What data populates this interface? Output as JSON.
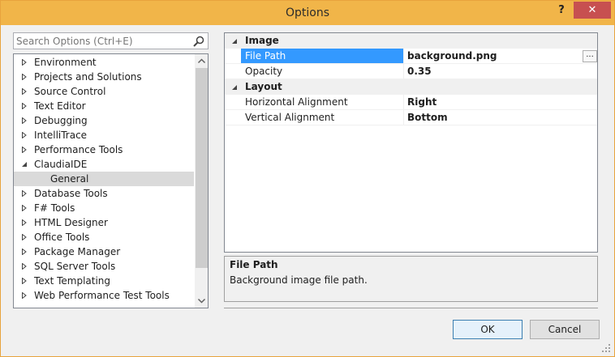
{
  "window": {
    "title": "Options",
    "help": "?",
    "close": "✕"
  },
  "search": {
    "placeholder": "Search Options (Ctrl+E)"
  },
  "tree": {
    "items": [
      {
        "label": "Environment",
        "level": 0,
        "state": "collapsed"
      },
      {
        "label": "Projects and Solutions",
        "level": 0,
        "state": "collapsed"
      },
      {
        "label": "Source Control",
        "level": 0,
        "state": "collapsed"
      },
      {
        "label": "Text Editor",
        "level": 0,
        "state": "collapsed"
      },
      {
        "label": "Debugging",
        "level": 0,
        "state": "collapsed"
      },
      {
        "label": "IntelliTrace",
        "level": 0,
        "state": "collapsed"
      },
      {
        "label": "Performance Tools",
        "level": 0,
        "state": "collapsed"
      },
      {
        "label": "ClaudiaIDE",
        "level": 0,
        "state": "expanded"
      },
      {
        "label": "General",
        "level": 1,
        "state": "leaf",
        "selected": true
      },
      {
        "label": "Database Tools",
        "level": 0,
        "state": "collapsed"
      },
      {
        "label": "F# Tools",
        "level": 0,
        "state": "collapsed"
      },
      {
        "label": "HTML Designer",
        "level": 0,
        "state": "collapsed"
      },
      {
        "label": "Office Tools",
        "level": 0,
        "state": "collapsed"
      },
      {
        "label": "Package Manager",
        "level": 0,
        "state": "collapsed"
      },
      {
        "label": "SQL Server Tools",
        "level": 0,
        "state": "collapsed"
      },
      {
        "label": "Text Templating",
        "level": 0,
        "state": "collapsed"
      },
      {
        "label": "Web Performance Test Tools",
        "level": 0,
        "state": "collapsed"
      }
    ]
  },
  "properties": {
    "image_category": "Image",
    "file_path_label": "File Path",
    "file_path_value": "background.png",
    "opacity_label": "Opacity",
    "opacity_value": "0.35",
    "layout_category": "Layout",
    "h_align_label": "Horizontal Alignment",
    "h_align_value": "Right",
    "v_align_label": "Vertical Alignment",
    "v_align_value": "Bottom",
    "ellipsis": "..."
  },
  "description": {
    "title": "File Path",
    "text": "Background image file path."
  },
  "buttons": {
    "ok": "OK",
    "cancel": "Cancel"
  },
  "colors": {
    "titlebar": "#f1b549",
    "selection": "#3399ff",
    "close": "#c75050"
  }
}
